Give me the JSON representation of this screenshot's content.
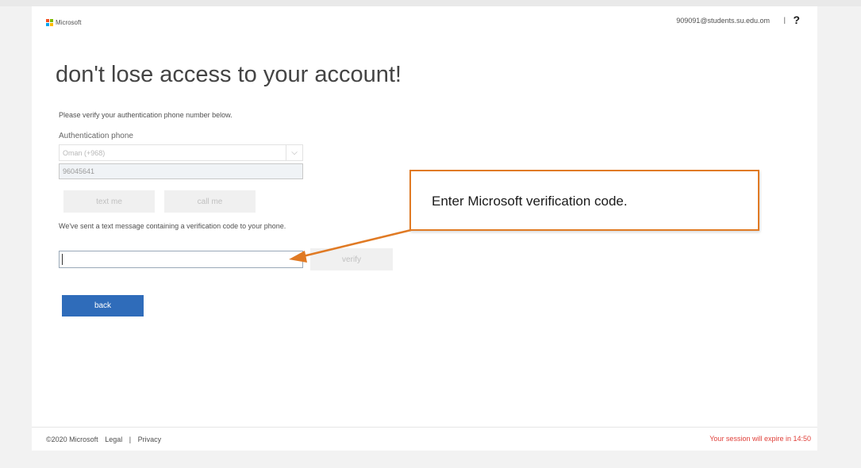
{
  "header": {
    "logo_text": "Microsoft",
    "account": "909091@students.su.edu.om",
    "separator": "|",
    "help": "?"
  },
  "main": {
    "title": "don't lose access to your account!",
    "instruction": "Please verify your authentication phone number below.",
    "phone_label": "Authentication phone",
    "country_value": "Oman (+968)",
    "phone_value": "96045641",
    "text_me_label": "text me",
    "call_me_label": "call me",
    "sent_message": "We've sent a text message containing a verification code to your phone.",
    "code_value": "",
    "verify_label": "verify",
    "back_label": "back"
  },
  "footer": {
    "copyright": "©2020 Microsoft",
    "legal": "Legal",
    "separator": "|",
    "privacy": "Privacy",
    "session": "Your session will expire in 14:50"
  },
  "callout": {
    "text": "Enter Microsoft verification code."
  },
  "icons": {
    "logo": "microsoft-logo-icon",
    "dropdown": "chevron-down-icon"
  },
  "colors": {
    "accent": "#2f6cba",
    "callout_border": "#e07a24",
    "session_warning": "#e0403a",
    "logo_red": "#f25022",
    "logo_green": "#7fba00",
    "logo_blue": "#00a4ef",
    "logo_yellow": "#ffb900"
  }
}
